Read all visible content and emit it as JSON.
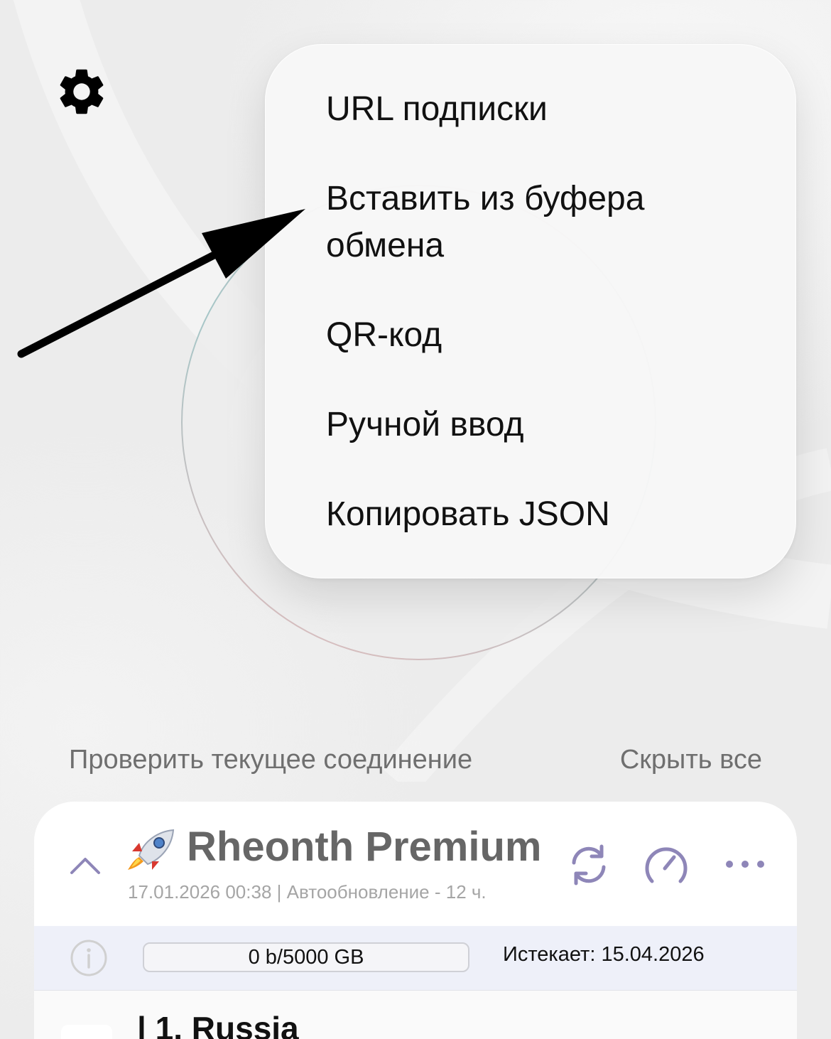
{
  "menu": {
    "items": [
      {
        "label": "URL подписки"
      },
      {
        "label": "Вставить из буфера обмена"
      },
      {
        "label": "QR-код"
      },
      {
        "label": "Ручной ввод"
      },
      {
        "label": "Копировать JSON"
      }
    ]
  },
  "actions": {
    "check_connection": "Проверить текущее соединение",
    "hide_all": "Скрыть все"
  },
  "subscription": {
    "name": "Rheonth Premium",
    "emoji_icon": "rocket-icon",
    "meta": "17.01.2026 00:38 | Автообновление - 12 ч.",
    "usage_text": "0 b/5000 GB",
    "usage_fraction": 0,
    "expires": "Истекает: 15.04.2026",
    "servers": [
      {
        "name": "| 1. Russia"
      }
    ]
  },
  "icons": {
    "settings": "gear-icon",
    "collapse": "chevron-up-icon",
    "refresh": "refresh-icon",
    "speedtest": "speedometer-icon",
    "more": "more-dots-icon",
    "info": "info-icon"
  },
  "colors": {
    "accent": "#8e86b8",
    "info_strip": "#eef0f9",
    "ring_teal": "#9dc2c3",
    "ring_pink": "#d8b4b8"
  }
}
